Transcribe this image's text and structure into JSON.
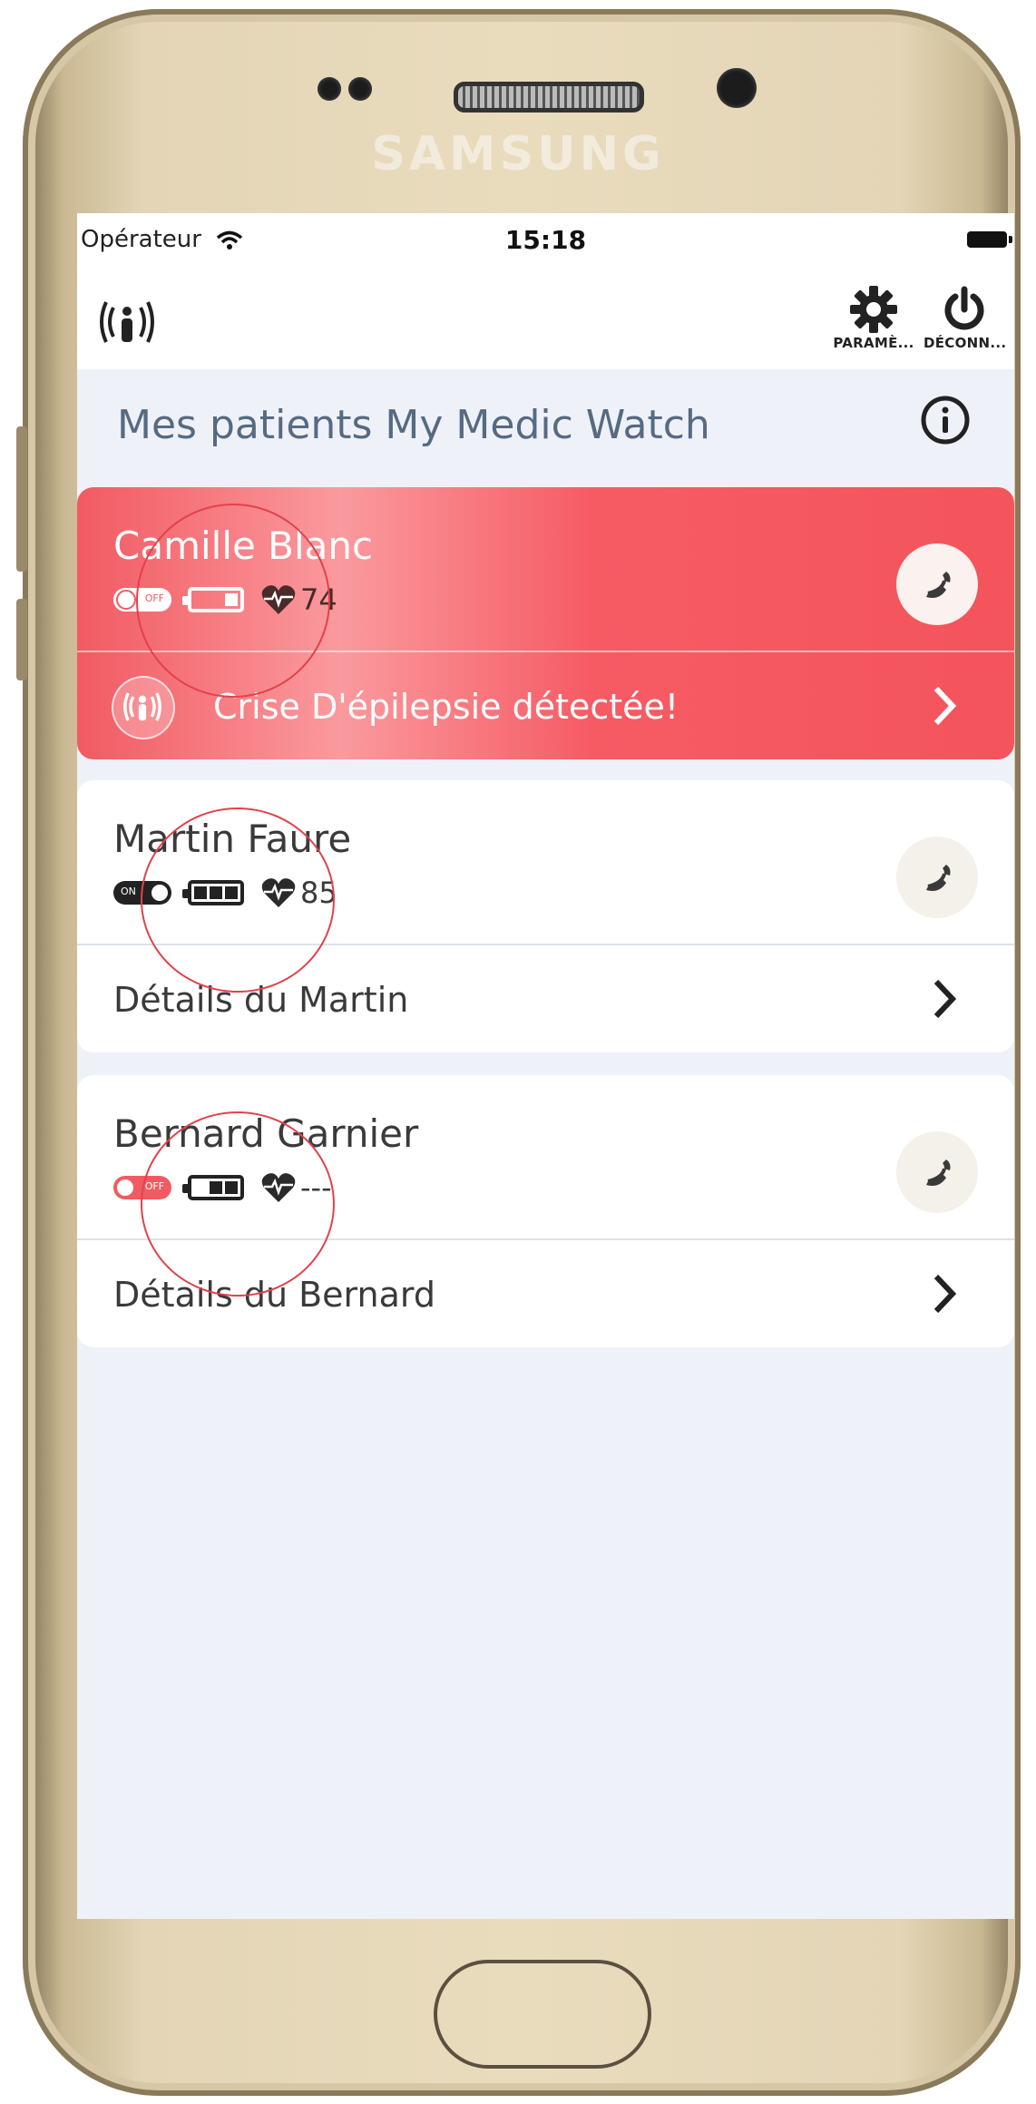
{
  "device": {
    "brand": "SAMSUNG"
  },
  "status_bar": {
    "carrier": "Opérateur",
    "time": "15:18"
  },
  "navbar": {
    "settings_label": "PARAMÈ...",
    "logout_label": "DÉCONN..."
  },
  "section": {
    "title": "Mes patients My Medic Watch"
  },
  "patients": [
    {
      "name": "Camille Blanc",
      "status": "alert",
      "watch_toggle": "OFF",
      "battery_level": 0.33,
      "heart_rate": "74",
      "detail_text": "Crise D'épilepsie détectée!"
    },
    {
      "name": "Martin Faure",
      "status": "normal",
      "watch_toggle": "ON",
      "battery_level": 1.0,
      "heart_rate": "85",
      "detail_text": "Détails du Martin"
    },
    {
      "name": "Bernard Garnier",
      "status": "normal",
      "watch_toggle": "OFF",
      "battery_level": 0.66,
      "heart_rate": "---",
      "detail_text": "Détails du Bernard"
    }
  ],
  "colors": {
    "alert_red": "#f4545c",
    "title_slate": "#566a82",
    "background": "#eef2f8",
    "toggle_on": "#222222",
    "toggle_off": "#f25a62"
  }
}
